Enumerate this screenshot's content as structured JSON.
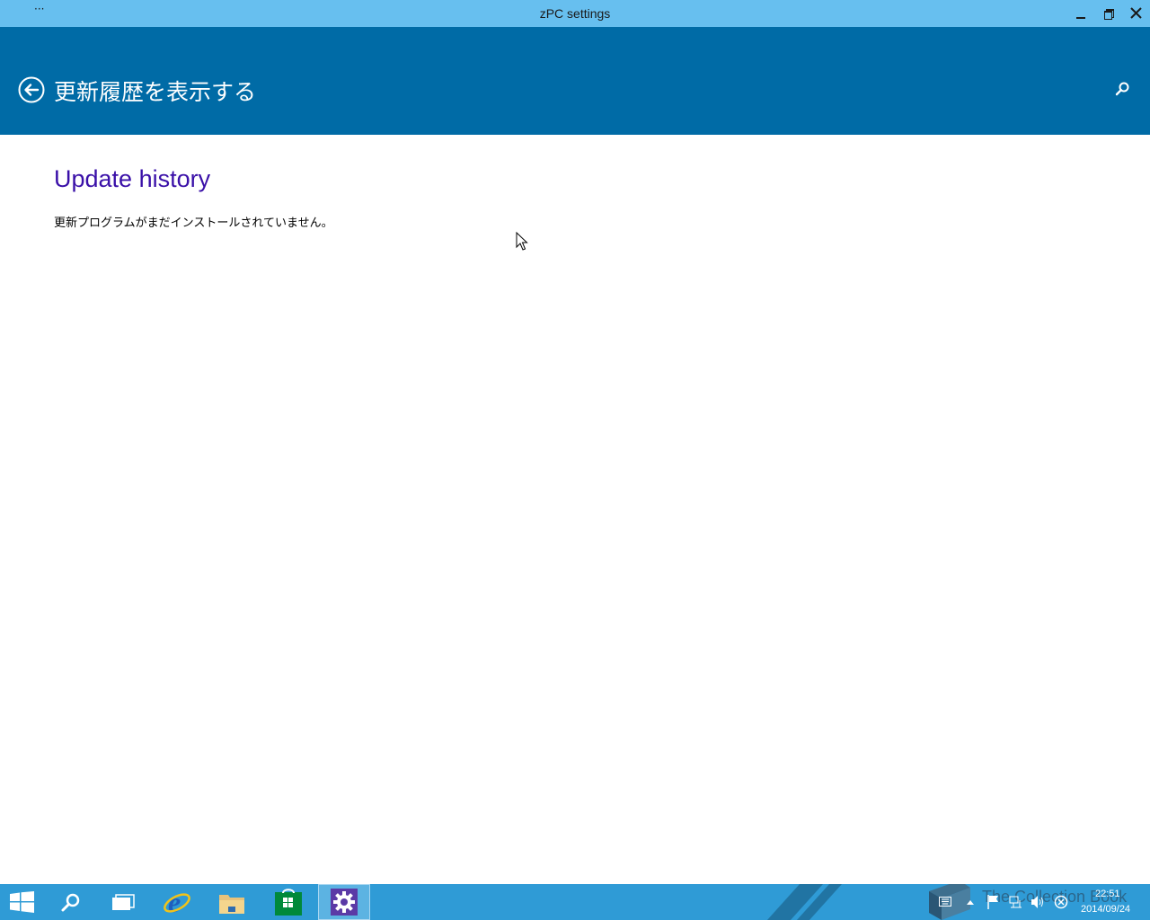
{
  "window": {
    "title": "zPC settings",
    "menu_label": "···"
  },
  "header": {
    "page_title": "更新履歴を表示する"
  },
  "content": {
    "section_title": "Update history",
    "status_text": "更新プログラムがまだインストールされていません。"
  },
  "taskbar": {
    "items": [
      {
        "name": "start",
        "icon": "windows-logo-icon"
      },
      {
        "name": "search",
        "icon": "search-icon"
      },
      {
        "name": "task-view",
        "icon": "task-view-icon"
      },
      {
        "name": "internet-explorer",
        "icon": "internet-explorer-icon"
      },
      {
        "name": "file-explorer",
        "icon": "folder-icon"
      },
      {
        "name": "store",
        "icon": "store-icon"
      },
      {
        "name": "pc-settings",
        "icon": "gear-icon",
        "active": true
      }
    ],
    "watermark": "The Collection Book",
    "clock_time": "22:51",
    "clock_date": "2014/09/24"
  },
  "colors": {
    "titlebar": "#67bfef",
    "header": "#006ba6",
    "section_title": "#3a10a8",
    "taskbar": "#2f9bd6"
  }
}
